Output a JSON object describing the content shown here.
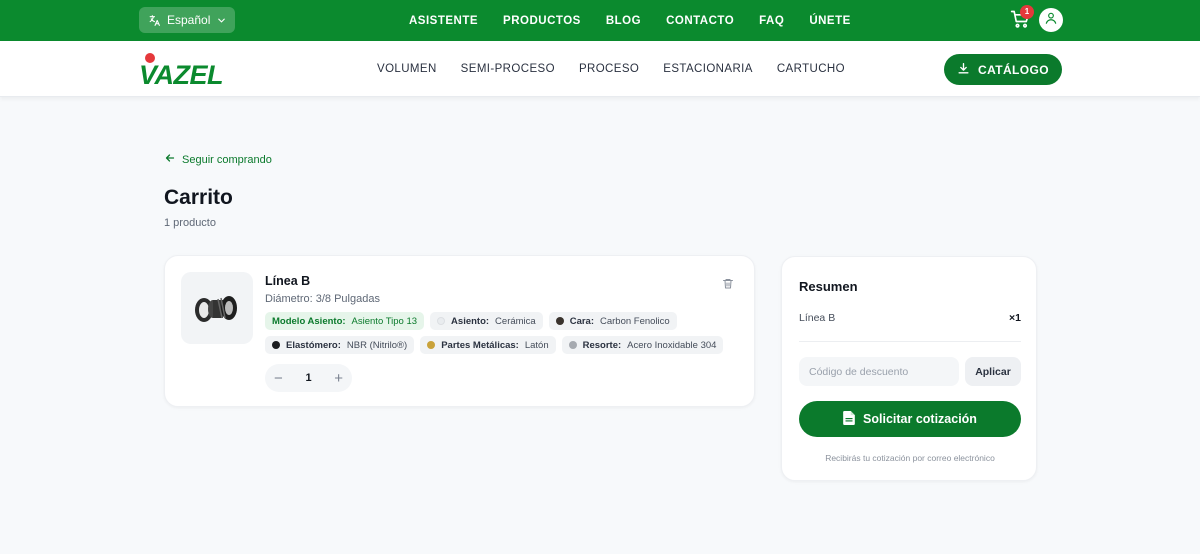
{
  "topbar": {
    "language": "Español",
    "nav": [
      "ASISTENTE",
      "PRODUCTOS",
      "BLOG",
      "CONTACTO",
      "FAQ",
      "ÚNETE"
    ],
    "cart_count": "1"
  },
  "header": {
    "logo_text": "VAZEL",
    "categories": [
      "VOLUMEN",
      "SEMI-PROCESO",
      "PROCESO",
      "ESTACIONARIA",
      "CARTUCHO"
    ],
    "catalog_label": "CATÁLOGO"
  },
  "page": {
    "back_label": "Seguir comprando",
    "title": "Carrito",
    "count": "1 producto"
  },
  "item": {
    "name": "Línea B",
    "diameter": "Diámetro: 3/8 Pulgadas",
    "attributes": [
      {
        "key": "Modelo Asiento:",
        "value": "Asiento Tipo 13",
        "dot": ""
      },
      {
        "key": "Asiento:",
        "value": "Cerámica",
        "dot": "#e9ecef"
      },
      {
        "key": "Cara:",
        "value": "Carbon Fenolico",
        "dot": "#3a332d"
      },
      {
        "key": "Elastómero:",
        "value": "NBR (Nitrilo®)",
        "dot": "#1b1d20"
      },
      {
        "key": "Partes Metálicas:",
        "value": "Latón",
        "dot": "#c9a23a"
      },
      {
        "key": "Resorte:",
        "value": "Acero Inoxidable 304",
        "dot": "#a6aab0"
      }
    ],
    "quantity": "1"
  },
  "summary": {
    "title": "Resumen",
    "line_name": "Línea B",
    "line_qty": "×1",
    "discount_placeholder": "Código de descuento",
    "apply_label": "Aplicar",
    "quote_label": "Solicitar cotización",
    "note": "Recibirás tu cotización por correo electrónico"
  },
  "colors": {
    "brand_green": "#0b8a2e",
    "button_green": "#0b7a2c",
    "badge_red": "#e5383b"
  }
}
